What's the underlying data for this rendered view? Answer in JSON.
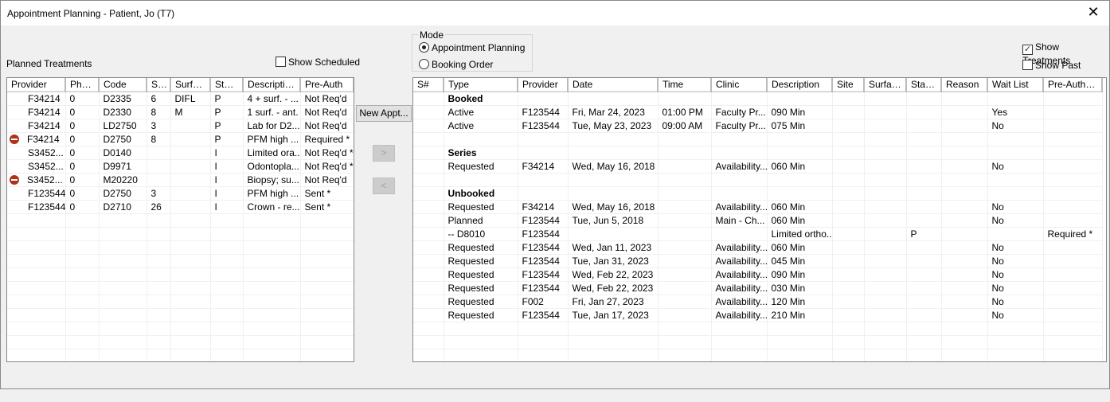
{
  "window": {
    "title": "Appointment Planning - Patient, Jo (T7)"
  },
  "left": {
    "label": "Planned Treatments",
    "show_scheduled": "Show Scheduled",
    "columns": [
      "Provider",
      "Phase",
      "Code",
      "Site",
      "Surface",
      "Status",
      "Description",
      "Pre-Auth"
    ],
    "rows": [
      {
        "icon": "",
        "cells": [
          "F34214",
          "0",
          "D2335",
          "6",
          "DIFL",
          "P",
          "4 + surf. - ...",
          "Not Req'd"
        ]
      },
      {
        "icon": "",
        "cells": [
          "F34214",
          "0",
          "D2330",
          "8",
          "M",
          "P",
          "1 surf. - ant.",
          "Not Req'd"
        ]
      },
      {
        "icon": "",
        "cells": [
          "F34214",
          "0",
          "LD2750",
          "3",
          "",
          "P",
          "Lab for D2...",
          "Not Req'd"
        ]
      },
      {
        "icon": "stop-icon",
        "cells": [
          "F34214",
          "0",
          "D2750",
          "8",
          "",
          "P",
          "PFM high ...",
          "Required *"
        ]
      },
      {
        "icon": "",
        "cells": [
          "S3452...",
          "0",
          "D0140",
          "",
          "",
          "I",
          "Limited ora...",
          "Not Req'd *"
        ]
      },
      {
        "icon": "",
        "cells": [
          "S3452...",
          "0",
          "D9971",
          "",
          "",
          "I",
          "Odontopla...",
          "Not Req'd *"
        ]
      },
      {
        "icon": "stop-icon",
        "cells": [
          "S3452...",
          "0",
          "M20220",
          "",
          "",
          "I",
          "Biopsy; su...",
          "Not Req'd"
        ]
      },
      {
        "icon": "",
        "cells": [
          "F123544",
          "0",
          "D2750",
          "3",
          "",
          "I",
          "PFM high ...",
          "Sent *"
        ]
      },
      {
        "icon": "",
        "cells": [
          "F123544",
          "0",
          "D2710",
          "26",
          "",
          "I",
          "Crown - re...",
          "Sent *"
        ]
      }
    ]
  },
  "middle": {
    "new_appt": "New Appt...",
    "move_right": ">",
    "move_left": "<"
  },
  "mode": {
    "legend": "Mode",
    "options": [
      "Appointment Planning",
      "Booking Order"
    ],
    "selected": 0
  },
  "options": {
    "show_treatments": "Show Treatments",
    "show_treatments_checked": true,
    "show_past": "Show Past",
    "show_past_checked": false
  },
  "right": {
    "columns": [
      "S#",
      "Type",
      "Provider",
      "Date",
      "Time",
      "Clinic",
      "Description",
      "Site",
      "Surface",
      "Status",
      "Reason",
      "Wait List",
      "Pre-Auth (o..."
    ],
    "rows": [
      {
        "group": "Booked"
      },
      {
        "cells": [
          "",
          "Active",
          "F123544",
          "Fri, Mar 24, 2023",
          "01:00 PM",
          "Faculty Pr...",
          "090 Min",
          "",
          "",
          "",
          "",
          "Yes",
          ""
        ]
      },
      {
        "cells": [
          "",
          "Active",
          "F123544",
          "Tue, May 23, 2023",
          "09:00 AM",
          "Faculty Pr...",
          "075 Min",
          "",
          "",
          "",
          "",
          "No",
          ""
        ]
      },
      {
        "cells": [
          "",
          "",
          "",
          "",
          "",
          "",
          "",
          "",
          "",
          "",
          "",
          "",
          ""
        ]
      },
      {
        "group": "Series"
      },
      {
        "cells": [
          "",
          "Requested",
          "F34214",
          "Wed, May 16, 2018",
          "",
          "Availability...",
          "060 Min",
          "",
          "",
          "",
          "",
          "No",
          ""
        ]
      },
      {
        "cells": [
          "",
          "",
          "",
          "",
          "",
          "",
          "",
          "",
          "",
          "",
          "",
          "",
          ""
        ]
      },
      {
        "group": "Unbooked"
      },
      {
        "cells": [
          "",
          "Requested",
          "F34214",
          "Wed, May 16, 2018",
          "",
          "Availability...",
          "060 Min",
          "",
          "",
          "",
          "",
          "No",
          ""
        ]
      },
      {
        "cells": [
          "",
          "Planned",
          "F123544",
          "Tue, Jun 5, 2018",
          "",
          "Main - Ch...",
          "060 Min",
          "",
          "",
          "",
          "",
          "No",
          ""
        ]
      },
      {
        "cells": [
          "",
          "-- D8010",
          "F123544",
          "",
          "",
          "",
          "Limited ortho...",
          "",
          "",
          "P",
          "",
          "",
          "Required *"
        ]
      },
      {
        "cells": [
          "",
          "Requested",
          "F123544",
          "Wed, Jan 11, 2023",
          "",
          "Availability...",
          "060 Min",
          "",
          "",
          "",
          "",
          "No",
          ""
        ]
      },
      {
        "cells": [
          "",
          "Requested",
          "F123544",
          "Tue, Jan 31, 2023",
          "",
          "Availability...",
          "045 Min",
          "",
          "",
          "",
          "",
          "No",
          ""
        ]
      },
      {
        "cells": [
          "",
          "Requested",
          "F123544",
          "Wed, Feb 22, 2023",
          "",
          "Availability...",
          "090 Min",
          "",
          "",
          "",
          "",
          "No",
          ""
        ]
      },
      {
        "cells": [
          "",
          "Requested",
          "F123544",
          "Wed, Feb 22, 2023",
          "",
          "Availability...",
          "030 Min",
          "",
          "",
          "",
          "",
          "No",
          ""
        ]
      },
      {
        "cells": [
          "",
          "Requested",
          "F002",
          "Fri, Jan 27, 2023",
          "",
          "Availability...",
          "120 Min",
          "",
          "",
          "",
          "",
          "No",
          ""
        ]
      },
      {
        "cells": [
          "",
          "Requested",
          "F123544",
          "Tue, Jan 17, 2023",
          "",
          "Availability...",
          "210 Min",
          "",
          "",
          "",
          "",
          "No",
          ""
        ]
      }
    ]
  }
}
